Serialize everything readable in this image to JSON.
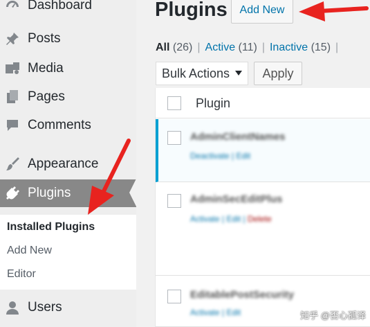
{
  "sidebar": {
    "items": [
      {
        "label": "Dashboard",
        "icon": "dashboard-icon"
      },
      {
        "label": "Posts",
        "icon": "pin-icon"
      },
      {
        "label": "Media",
        "icon": "media-icon"
      },
      {
        "label": "Pages",
        "icon": "pages-icon"
      },
      {
        "label": "Comments",
        "icon": "comment-icon"
      },
      {
        "label": "Appearance",
        "icon": "brush-icon"
      },
      {
        "label": "Plugins",
        "icon": "plug-icon"
      },
      {
        "label": "Users",
        "icon": "user-icon"
      }
    ],
    "submenu": [
      {
        "label": "Installed Plugins"
      },
      {
        "label": "Add New"
      },
      {
        "label": "Editor"
      }
    ]
  },
  "main": {
    "title": "Plugins",
    "add_new_label": "Add New",
    "filters": {
      "all_label": "All",
      "all_count": "(26)",
      "active_label": "Active",
      "active_count": "(11)",
      "inactive_label": "Inactive",
      "inactive_count": "(15)",
      "separator": "|"
    },
    "bulk_actions": {
      "selected": "Bulk Actions"
    },
    "apply_label": "Apply",
    "table": {
      "column_header": "Plugin",
      "rows": [
        {
          "name": "AdminClientNames",
          "actions": [
            "Deactivate",
            "Edit"
          ],
          "state": "active"
        },
        {
          "name": "AdminSecEditPlus",
          "actions": [
            "Activate",
            "Edit",
            "Delete"
          ],
          "state": "inactive"
        },
        {
          "name": "EditablePostSecurity",
          "actions": [
            "Activate",
            "Edit"
          ],
          "state": "inactive"
        }
      ]
    }
  },
  "watermark": "知乎 @否心孤译",
  "colors": {
    "accent": "#0073aa",
    "active_menu": "#888888",
    "annotation_arrow": "#e8231f",
    "active_row_border": "#00a0d2"
  }
}
